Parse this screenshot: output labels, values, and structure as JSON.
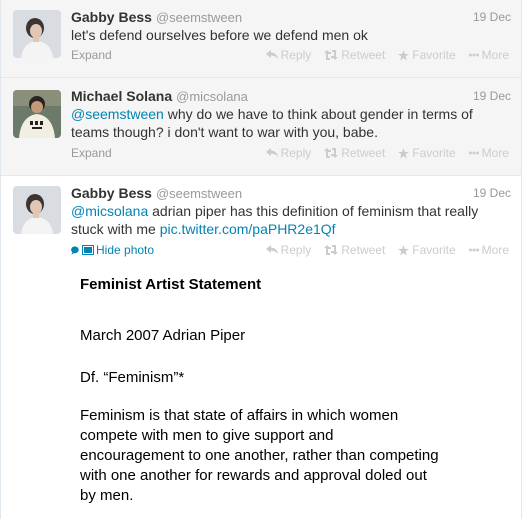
{
  "tweets": [
    {
      "fullname": "Gabby Bess",
      "username": "@seemstween",
      "time": "19 Dec",
      "text": "let's defend ourselves before we defend men ok",
      "expand_label": "Expand"
    },
    {
      "fullname": "Michael Solana",
      "username": "@micsolana",
      "time": "19 Dec",
      "mention": "@seemstween",
      "text": " why do we have to think about gender in terms of teams though? i don't want to war with you, babe.",
      "expand_label": "Expand"
    },
    {
      "fullname": "Gabby Bess",
      "username": "@seemstween",
      "time": "19 Dec",
      "mention": "@micsolana",
      "text": " adrian piper has this definition of feminism that really stuck with me ",
      "link": "pic.twitter.com/paPHR2e1Qf",
      "hide_photo_label": "Hide photo"
    }
  ],
  "actions": {
    "reply": "Reply",
    "retweet": "Retweet",
    "favorite": "Favorite",
    "more": "More"
  },
  "photo": {
    "title": "Feminist Artist Statement",
    "date": "March 2007 Adrian Piper",
    "definition_heading": "Df. “Feminism”*",
    "body": "Feminism is that state of affairs in which women compete with men to give support and encouragement to one another, rather than competing with one another for rewards and approval doled out by men."
  },
  "colors": {
    "link": "#0084b4",
    "muted": "#999999",
    "action": "#cccccc",
    "shaded_bg": "#f5f5f5"
  }
}
